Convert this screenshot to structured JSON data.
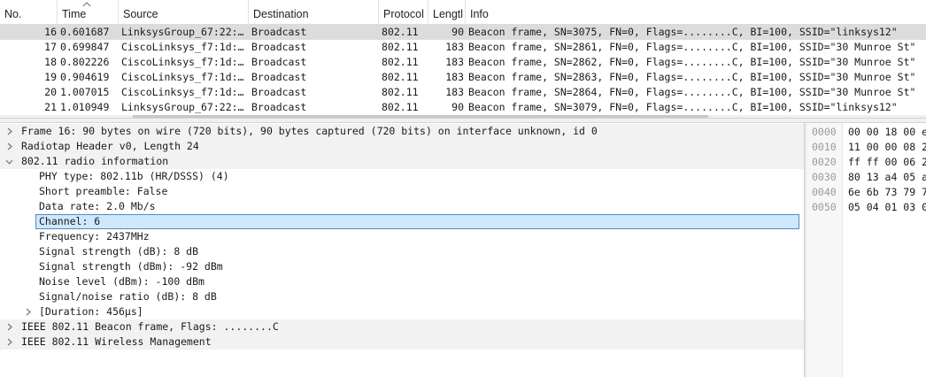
{
  "packet_list": {
    "columns": [
      {
        "label": "No."
      },
      {
        "label": "Time"
      },
      {
        "label": "Source"
      },
      {
        "label": "Destination"
      },
      {
        "label": "Protocol"
      },
      {
        "label": "Lengtl"
      },
      {
        "label": "Info"
      }
    ],
    "sorted_column": "Time",
    "selected_no": "16",
    "rows": [
      {
        "no": "16",
        "time": "0.601687",
        "source": "LinksysGroup_67:22:…",
        "destination": "Broadcast",
        "protocol": "802.11",
        "length": "90",
        "info": "Beacon frame, SN=3075, FN=0, Flags=........C, BI=100, SSID=\"linksys12\""
      },
      {
        "no": "17",
        "time": "0.699847",
        "source": "CiscoLinksys_f7:1d:…",
        "destination": "Broadcast",
        "protocol": "802.11",
        "length": "183",
        "info": "Beacon frame, SN=2861, FN=0, Flags=........C, BI=100, SSID=\"30 Munroe St\""
      },
      {
        "no": "18",
        "time": "0.802226",
        "source": "CiscoLinksys_f7:1d:…",
        "destination": "Broadcast",
        "protocol": "802.11",
        "length": "183",
        "info": "Beacon frame, SN=2862, FN=0, Flags=........C, BI=100, SSID=\"30 Munroe St\""
      },
      {
        "no": "19",
        "time": "0.904619",
        "source": "CiscoLinksys_f7:1d:…",
        "destination": "Broadcast",
        "protocol": "802.11",
        "length": "183",
        "info": "Beacon frame, SN=2863, FN=0, Flags=........C, BI=100, SSID=\"30 Munroe St\""
      },
      {
        "no": "20",
        "time": "1.007015",
        "source": "CiscoLinksys_f7:1d:…",
        "destination": "Broadcast",
        "protocol": "802.11",
        "length": "183",
        "info": "Beacon frame, SN=2864, FN=0, Flags=........C, BI=100, SSID=\"30 Munroe St\""
      },
      {
        "no": "21",
        "time": "1.010949",
        "source": "LinksysGroup_67:22:…",
        "destination": "Broadcast",
        "protocol": "802.11",
        "length": "90",
        "info": "Beacon frame, SN=3079, FN=0, Flags=........C, BI=100, SSID=\"linksys12\""
      }
    ]
  },
  "details": {
    "selected_item": "Channel: 6",
    "items": [
      {
        "label": "Frame 16: 90 bytes on wire (720 bits), 90 bytes captured (720 bits) on interface unknown, id 0",
        "level": 0,
        "state": "collapsed"
      },
      {
        "label": "Radiotap Header v0, Length 24",
        "level": 0,
        "state": "collapsed"
      },
      {
        "label": "802.11 radio information",
        "level": 0,
        "state": "expanded"
      },
      {
        "label": "PHY type: 802.11b (HR/DSSS) (4)",
        "level": 1,
        "state": "leaf"
      },
      {
        "label": "Short preamble: False",
        "level": 1,
        "state": "leaf"
      },
      {
        "label": "Data rate: 2.0 Mb/s",
        "level": 1,
        "state": "leaf"
      },
      {
        "label": "Channel: 6",
        "level": 1,
        "state": "leaf"
      },
      {
        "label": "Frequency: 2437MHz",
        "level": 1,
        "state": "leaf"
      },
      {
        "label": "Signal strength (dB): 8 dB",
        "level": 1,
        "state": "leaf"
      },
      {
        "label": "Signal strength (dBm): -92 dBm",
        "level": 1,
        "state": "leaf"
      },
      {
        "label": "Noise level (dBm): -100 dBm",
        "level": 1,
        "state": "leaf"
      },
      {
        "label": "Signal/noise ratio (dB): 8 dB",
        "level": 1,
        "state": "leaf"
      },
      {
        "label": "[Duration: 456µs]",
        "level": 1,
        "state": "collapsed"
      },
      {
        "label": "IEEE 802.11 Beacon frame, Flags: ........C",
        "level": 0,
        "state": "collapsed"
      },
      {
        "label": "IEEE 802.11 Wireless Management",
        "level": 0,
        "state": "collapsed"
      }
    ]
  },
  "hex_dump": {
    "rows": [
      {
        "offset": "0000",
        "bytes": "00 00 18 00 e"
      },
      {
        "offset": "0010",
        "bytes": "11 00 00 08 2"
      },
      {
        "offset": "0020",
        "bytes": "ff ff 00 06 2"
      },
      {
        "offset": "0030",
        "bytes": "80 13 a4 05 a"
      },
      {
        "offset": "0040",
        "bytes": "6e 6b 73 79 7"
      },
      {
        "offset": "0050",
        "bytes": "05 04 01 03 0"
      }
    ]
  },
  "icons": {
    "collapsed": "chevron-right-icon",
    "expanded": "chevron-down-icon",
    "sort": "sort-ascending-icon"
  },
  "colors": {
    "selected_packet_bg": "#dcdcdc",
    "selected_field_bg": "#cfe8fc",
    "selected_field_border": "#4b8fc7",
    "group_row_bg": "#f2f2f2"
  }
}
